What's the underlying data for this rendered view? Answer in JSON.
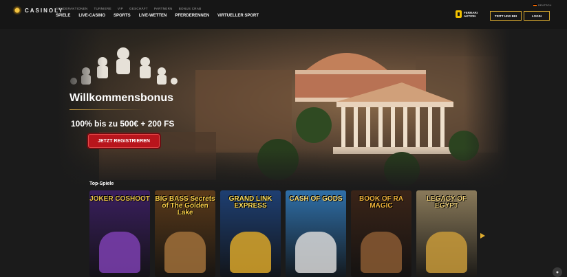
{
  "logo": {
    "text": "CASINOLY"
  },
  "top_nav": [
    "SONDERAKTIONEN",
    "TURNIERE",
    "VIP",
    "GESCHÄFT",
    "PARTNERN",
    "BONUS CRAB"
  ],
  "main_nav": [
    "SPIELE",
    "LIVE-CASINO",
    "SPORTS",
    "LIVE-WETTEN",
    "PFERDERENNEN",
    "VIRTUELLER SPORT"
  ],
  "partner": {
    "line1": "FERRARI",
    "line2": "AKTION"
  },
  "buttons": {
    "signup": "TRITT UNS BEI",
    "login": "LOGIN"
  },
  "language": "DEUTSCH",
  "hero": {
    "title": "Willkommensbonus",
    "subtitle": "100% bis zu 500€ + 200 FS",
    "cta": "JETZT REGISTRIEREN"
  },
  "section_title": "Top-Spiele",
  "games": [
    {
      "name": "JOKER COSHOOT",
      "color": "#e9c24a",
      "bg": "#3a1f5e",
      "art": "#7d3fb0"
    },
    {
      "name": "BIG BASS Secrets of The Golden Lake",
      "color": "#ffd24a",
      "bg": "#5a3a1a",
      "art": "#a0703a"
    },
    {
      "name": "GRAND LINK EXPRESS",
      "color": "#ffdf5a",
      "bg": "#1e3f72",
      "art": "#d9a629"
    },
    {
      "name": "CASH OF GODS",
      "color": "#ffe27a",
      "bg": "#2f6fa8",
      "art": "#d8d8d8"
    },
    {
      "name": "BOOK OF RA MAGIC",
      "color": "#f0b23a",
      "bg": "#3a2418",
      "art": "#8a5a32"
    },
    {
      "name": "LEGACY OF EGYPT",
      "color": "#f2d37a",
      "bg": "#8a7a5a",
      "art": "#c89a3a"
    }
  ]
}
